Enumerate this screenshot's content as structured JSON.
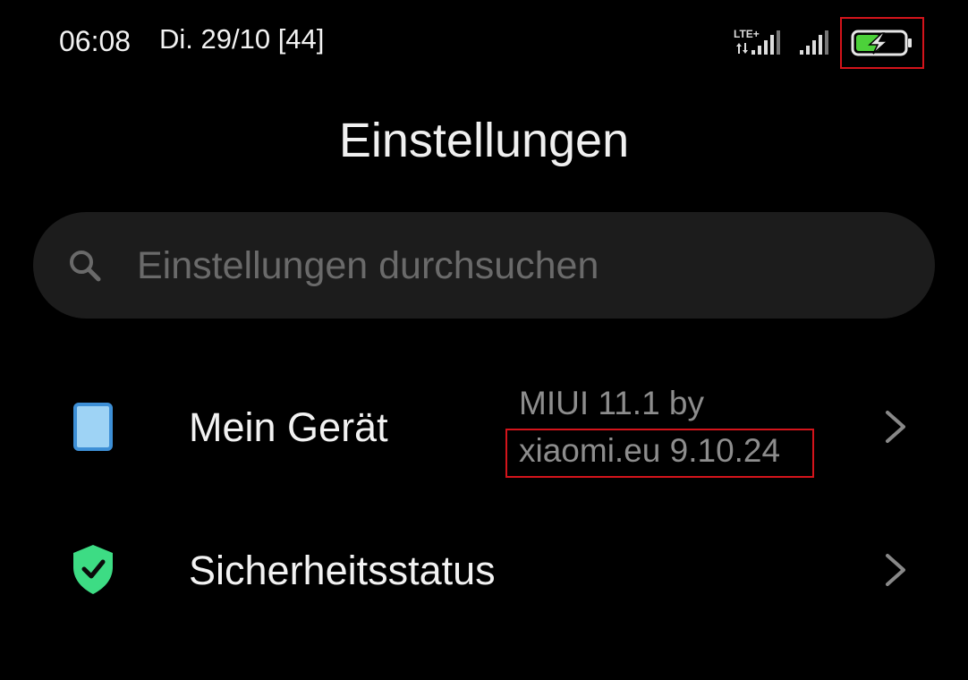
{
  "status_bar": {
    "time": "06:08",
    "date": "Di. 29/10 [44]",
    "network_label": "LTE+",
    "battery_charging": true,
    "battery_color": "#4cd13a"
  },
  "header": {
    "title": "Einstellungen"
  },
  "search": {
    "placeholder": "Einstellungen durchsuchen",
    "icon": "search-icon"
  },
  "settings_items": [
    {
      "icon": "phone-icon",
      "label": "Mein Gerät",
      "value_line1": "MIUI 11.1 by",
      "value_line2": "xiaomi.eu 9.10.24"
    },
    {
      "icon": "shield-check-icon",
      "label": "Sicherheitsstatus",
      "icon_color": "#3ddc84"
    }
  ],
  "highlight_color": "#d4141b"
}
